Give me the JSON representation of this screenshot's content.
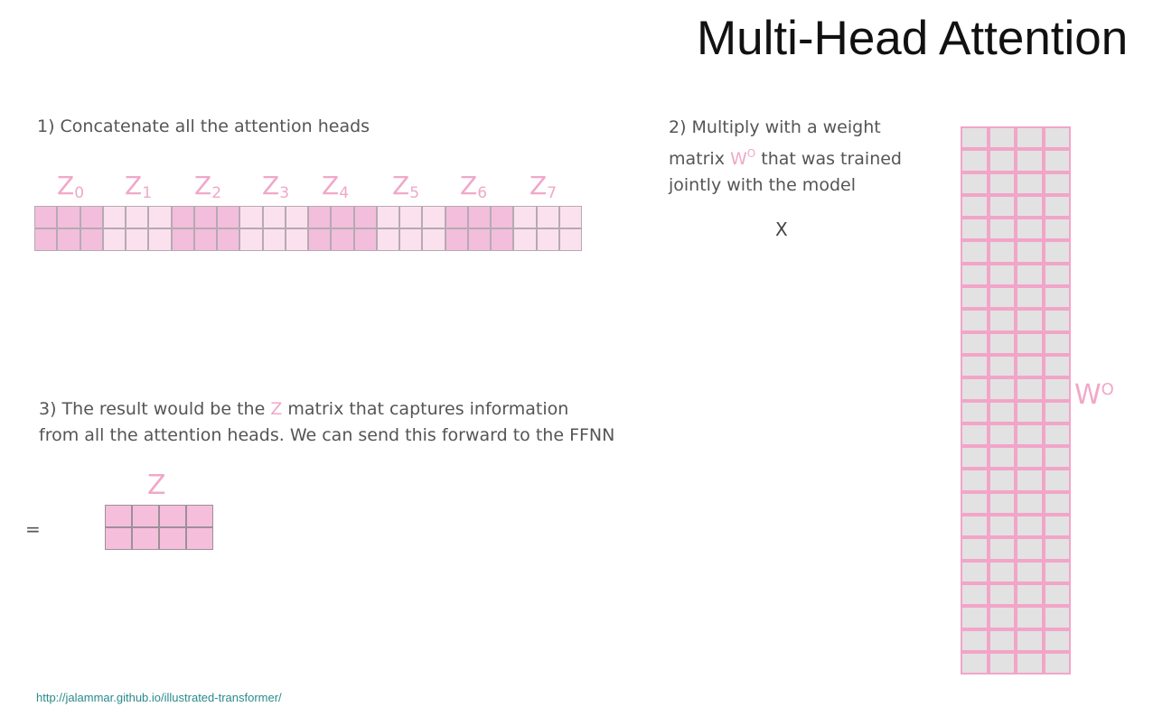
{
  "title": "Multi-Head Attention",
  "step1": {
    "text": "1) Concatenate all the attention heads"
  },
  "step2": {
    "line1": "2) Multiply with a weight",
    "line2_pre": "matrix ",
    "w_letter": "W",
    "w_sup": "O",
    "line2_post": " that was trained",
    "line3": "jointly with the model"
  },
  "step3": {
    "line1_pre": "3) The result would be the ",
    "z_letter": "Z",
    "line1_post": " matrix that captures information",
    "line2": "from all the attention heads. We can send this forward to the FFNN"
  },
  "heads": [
    {
      "letter": "Z",
      "sub": "0",
      "shade": "dark"
    },
    {
      "letter": "Z",
      "sub": "1",
      "shade": "light"
    },
    {
      "letter": "Z",
      "sub": "2",
      "shade": "dark"
    },
    {
      "letter": "Z",
      "sub": "3",
      "shade": "light"
    },
    {
      "letter": "Z",
      "sub": "4",
      "shade": "dark"
    },
    {
      "letter": "Z",
      "sub": "5",
      "shade": "light"
    },
    {
      "letter": "Z",
      "sub": "6",
      "shade": "dark"
    },
    {
      "letter": "Z",
      "sub": "7",
      "shade": "light"
    }
  ],
  "operators": {
    "times": "X",
    "equals": "="
  },
  "z_matrix_label": "Z",
  "w_matrix_label": {
    "letter": "W",
    "sup": "O"
  },
  "source_url": "http://jalammar.github.io/illustrated-transformer/",
  "colors": {
    "accent_pink": "#f0a8c9",
    "dark_cell": "#f2bedc",
    "light_cell": "#fbe1ee",
    "weight_cell": "#e2e2e2",
    "weight_border": "#f2a5c8"
  }
}
